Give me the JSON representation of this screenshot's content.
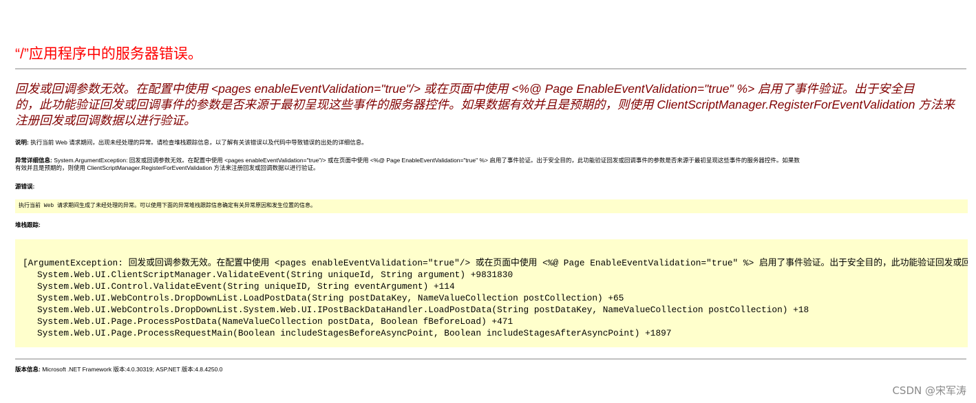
{
  "error_page": {
    "title": "“/”应用程序中的服务器错误。",
    "message_lines": [
      "回发或回调参数无效。在配置中使用 <pages enableEventValidation=\"true\"/> 或在页面中使用 <%@ Page EnableEventValidation=\"true\" %> 启用了事件验证。出于安全目",
      "的，此功能验证回发或回调事件的参数是否来源于最初呈现这些事件的服务器控件。如果数据有效并且是预期的，则使用 ClientScriptManager.RegisterForEventValidation 方法来",
      "注册回发或回调数据以进行验证。"
    ],
    "description": {
      "label": "说明:",
      "text": " 执行当前 Web 请求期间，出现未经处理的异常。请检查堆栈跟踪信息，以了解有关该错误以及代码中导致错误的出处的详细信息。"
    },
    "exception_details": {
      "label": "异常详细信息:",
      "line1": " System.ArgumentException: 回发或回调参数无效。在配置中使用 <pages enableEventValidation=\"true\"/> 或在页面中使用 <%@ Page EnableEventValidation=\"true\" %> 启用了事件验证。出于安全目的，此功能验证回发或回调事件的参数是否来源于最初呈现这些事件的服务器控件。如果数",
      "line2": "有效并且是预期的，则使用 ClientScriptManager.RegisterForEventValidation 方法来注册回发或回调数据以进行验证。"
    },
    "source_error": {
      "label": "源错误:",
      "text": "执行当前 Web 请求期间生成了未经处理的异常。可以使用下面的异常堆栈跟踪信息确定有关异常原因和发生位置的信息。"
    },
    "stack_trace": {
      "label": "堆栈跟踪:",
      "first_line": "[ArgumentException: 回发或回调参数无效。在配置中使用 <pages enableEventValidation=\"true\"/> 或在页面中使用 <%@ Page EnableEventValidation=\"true\" %> 启用了事件验证。出于安全目的，此功能验证回发或回",
      "frames": [
        "System.Web.UI.ClientScriptManager.ValidateEvent(String uniqueId, String argument) +9831830",
        "System.Web.UI.Control.ValidateEvent(String uniqueID, String eventArgument) +114",
        "System.Web.UI.WebControls.DropDownList.LoadPostData(String postDataKey, NameValueCollection postCollection) +65",
        "System.Web.UI.WebControls.DropDownList.System.Web.UI.IPostBackDataHandler.LoadPostData(String postDataKey, NameValueCollection postCollection) +18",
        "System.Web.UI.Page.ProcessPostData(NameValueCollection postData, Boolean fBeforeLoad) +471",
        "System.Web.UI.Page.ProcessRequestMain(Boolean includeStagesBeforeAsyncPoint, Boolean includeStagesAfterAsyncPoint) +1897"
      ]
    },
    "version_info": {
      "label": "版本信息:",
      "text": " Microsoft .NET Framework 版本:4.0.30319; ASP.NET 版本:4.8.4250.0"
    },
    "colors": {
      "title": "#ff0000",
      "message": "#800000",
      "code_background": "#ffffcc",
      "rule": "#c0c0c0"
    }
  },
  "watermark": "CSDN @宋军涛"
}
